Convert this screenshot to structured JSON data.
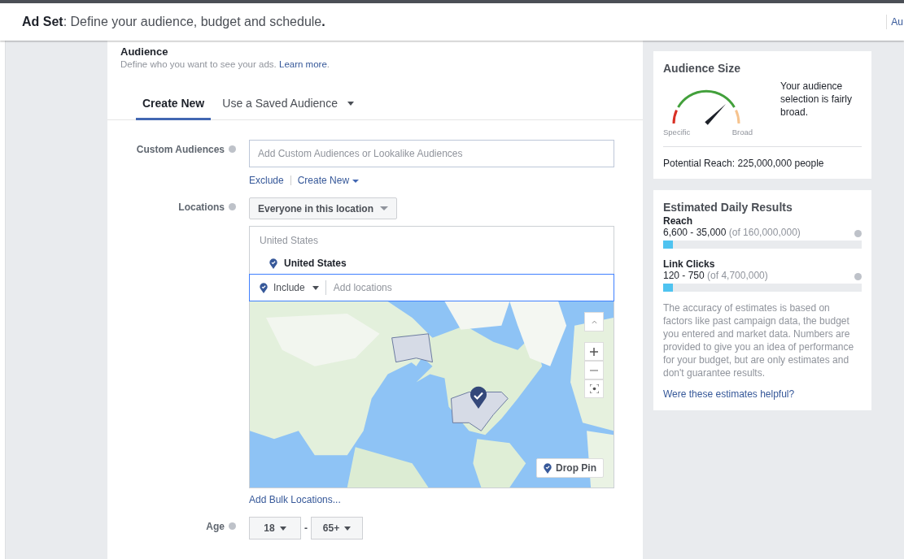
{
  "header": {
    "title": "**Ad Set**: Define your audience, budget and schedule**.**",
    "side_link": "Au"
  },
  "audience": {
    "title": "Audience",
    "description": "Define who you want to see your ads.",
    "link": "Learn more",
    "link_end": "."
  },
  "tabs": [
    {
      "label": "Create New",
      "selected": true,
      "dropdown": false
    },
    {
      "label": "Use a Saved Audience",
      "selected": false,
      "dropdown": true
    }
  ],
  "custom_audiences": {
    "label": "Custom Audiences",
    "placeholder": "Add Custom Audiences or Lookalike Audiences",
    "links": [
      {
        "label": "Exclude",
        "dropdown": false
      },
      {
        "label": "Create New",
        "dropdown": true
      }
    ]
  },
  "locations": {
    "label": "Locations",
    "mode": "Everyone in this location",
    "group_title": "United States",
    "selected": [
      {
        "name": "United States"
      }
    ],
    "include": "Include",
    "placeholder": "Add locations",
    "drop_pin": "Drop Pin",
    "bulk_link": "Add Bulk Locations..."
  },
  "age": {
    "label": "Age",
    "min": "18",
    "separator": "-",
    "max": "65+"
  },
  "audience_size": {
    "title": "Audience Size",
    "gauge": {
      "level": 0.75,
      "low_label": "Specific",
      "high_label": "Broad"
    },
    "summary": "Your audience selection is fairly broad.",
    "potential_reach": "Potential Reach: 225,000,000 people"
  },
  "daily_results": {
    "title": "Estimated Daily Results",
    "metrics": [
      {
        "name": "Reach",
        "range": "6,600 - 35,000",
        "total": "(of 160,000,000)",
        "level": 0.03
      },
      {
        "name": "Link Clicks",
        "range": "120 - 750",
        "total": "(of 4,700,000)",
        "level": 0.03
      }
    ],
    "note": "The accuracy of estimates is based on factors like past campaign data, the budget you entered and market data. Numbers are provided to give you an idea of performance for your budget, but are only estimates and don't guarantee results.",
    "helpful_link": "Were these estimates helpful?"
  }
}
